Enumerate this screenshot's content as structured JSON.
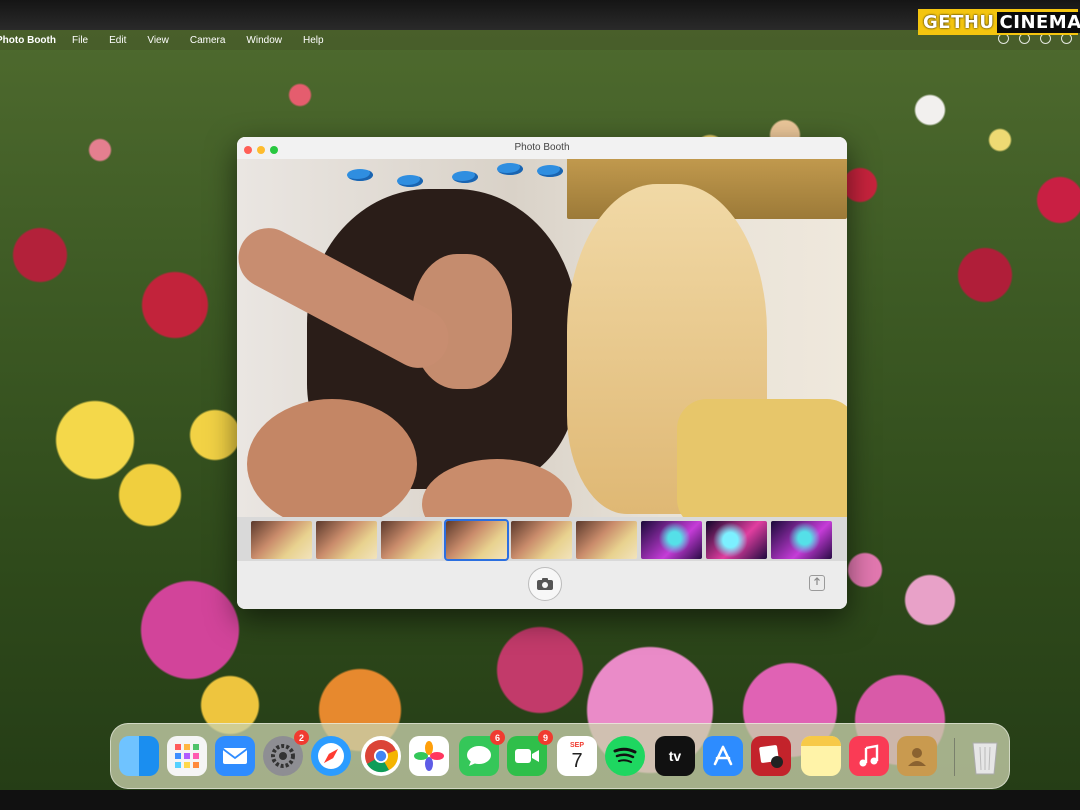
{
  "watermark": {
    "part1": "GETHU",
    "part2": "CINEMA"
  },
  "menubar": {
    "app_name": "Photo Booth",
    "items": [
      "File",
      "Edit",
      "View",
      "Camera",
      "Window",
      "Help"
    ]
  },
  "window": {
    "title": "Photo Booth"
  },
  "filmstrip": {
    "thumb_count": 9,
    "selected_index": 3
  },
  "dock": {
    "items": [
      {
        "name": "Finder",
        "icon": "finder-icon",
        "color": "#1a8ef0"
      },
      {
        "name": "Launchpad",
        "icon": "launchpad-icon",
        "color": "#f5f5f5"
      },
      {
        "name": "Mail",
        "icon": "mail-icon",
        "color": "#2f8cff"
      },
      {
        "name": "System Settings",
        "icon": "settings-gear-icon",
        "color": "#8e8e93",
        "badge": "2"
      },
      {
        "name": "Safari",
        "icon": "safari-compass-icon",
        "color": "#2b9cff"
      },
      {
        "name": "Chrome",
        "icon": "chrome-icon",
        "color": "#ffffff"
      },
      {
        "name": "Photos",
        "icon": "photos-icon",
        "color": "#ffffff"
      },
      {
        "name": "Messages",
        "icon": "messages-icon",
        "color": "#35c759",
        "badge": "6"
      },
      {
        "name": "FaceTime",
        "icon": "facetime-icon",
        "color": "#2fbf4a",
        "badge": "9"
      },
      {
        "name": "Calendar",
        "icon": "calendar-icon",
        "color": "#ffffff",
        "month": "SEP",
        "day": "7"
      },
      {
        "name": "Spotify",
        "icon": "spotify-icon",
        "color": "#1ed760"
      },
      {
        "name": "Apple TV",
        "icon": "appletv-icon",
        "color": "#111111",
        "text": "tv"
      },
      {
        "name": "App Store",
        "icon": "appstore-icon",
        "color": "#2d8cff"
      },
      {
        "name": "Photo Booth",
        "icon": "photobooth-icon",
        "color": "#c3232b"
      },
      {
        "name": "Notes",
        "icon": "notes-icon",
        "color": "#fff3a8"
      },
      {
        "name": "Music",
        "icon": "music-note-icon",
        "color": "#fa3b55"
      },
      {
        "name": "Contacts",
        "icon": "contacts-icon",
        "color": "#c99a4f"
      },
      {
        "name": "Trash",
        "icon": "trash-icon",
        "color": "#e6e6e6"
      }
    ]
  }
}
